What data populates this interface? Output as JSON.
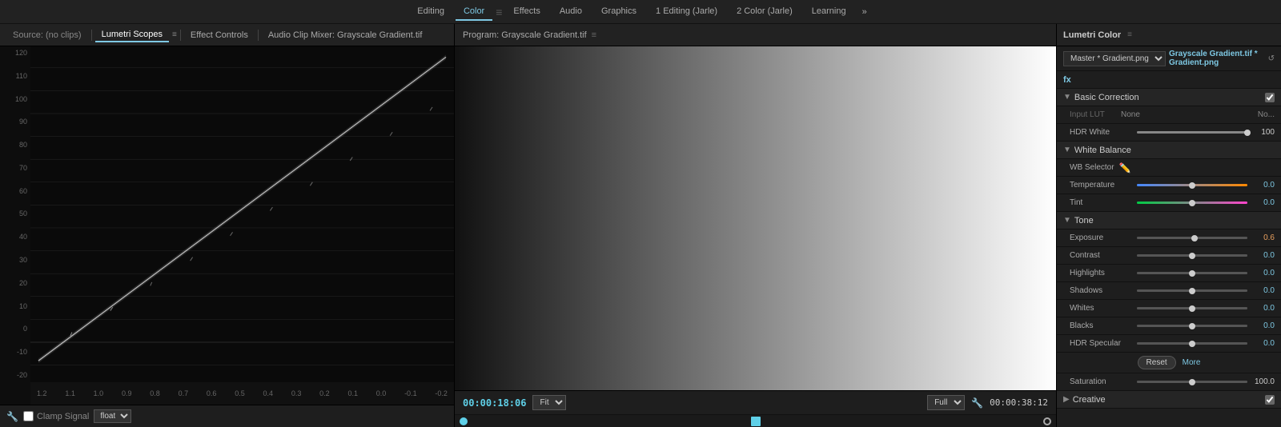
{
  "topNav": {
    "items": [
      {
        "label": "Editing",
        "active": false
      },
      {
        "label": "Color",
        "active": true
      },
      {
        "label": "Effects",
        "active": false
      },
      {
        "label": "Audio",
        "active": false
      },
      {
        "label": "Graphics",
        "active": false
      },
      {
        "label": "1 Editing (Jarle)",
        "active": false
      },
      {
        "label": "2 Color (Jarle)",
        "active": false
      },
      {
        "label": "Learning",
        "active": false
      }
    ],
    "moreIcon": "»"
  },
  "leftPanel": {
    "sourceLabel": "Source: (no clips)",
    "tabs": [
      {
        "label": "Lumetri Scopes",
        "active": true
      },
      {
        "label": "Effect Controls",
        "active": false
      },
      {
        "label": "Audio Clip Mixer: Grayscale Gradient.tif",
        "active": false
      }
    ],
    "menuIcon": "≡",
    "yAxisLabels": [
      "120",
      "110",
      "100",
      "90",
      "80",
      "70",
      "60",
      "50",
      "40",
      "30",
      "20",
      "10",
      "0",
      "-10",
      "-20"
    ],
    "xAxisLabels": [
      "1.2",
      "1.1",
      "1.0",
      "0.9",
      "0.8",
      "0.7",
      "0.6",
      "0.5",
      "0.4",
      "0.3",
      "0.2",
      "0.1",
      "0.0",
      "-0.1",
      "-0.2"
    ],
    "controls": {
      "clampSignalLabel": "Clamp Signal",
      "floatValue": "float"
    }
  },
  "centerPanel": {
    "programTitle": "Program: Grayscale Gradient.tif",
    "menuIcon": "≡",
    "timecode": "00:00:18:06",
    "fitOption": "Fit",
    "resolution": "Full",
    "duration": "00:00:38:12"
  },
  "rightPanel": {
    "title": "Lumetri Color",
    "menuIcon": "≡",
    "clipDropdown": "Master * Gradient.png",
    "clipName": "Grayscale Gradient.tif * Gradient.png",
    "resetIcon": "↺",
    "fxLabel": "fx",
    "sections": {
      "basicCorrection": {
        "label": "Basic Correction",
        "enabled": true,
        "inputLUT": {
          "label": "Input LUT",
          "value": "None",
          "edit": "No..."
        },
        "hdrWhite": {
          "label": "HDR White",
          "value": "100",
          "sliderPos": 100
        },
        "whiteBalance": {
          "label": "White Balance",
          "wbSelector": "WB Selector",
          "temperature": {
            "label": "Temperature",
            "value": "0.0",
            "sliderPos": 50
          },
          "tint": {
            "label": "Tint",
            "value": "0.0",
            "sliderPos": 50
          }
        },
        "tone": {
          "label": "Tone",
          "exposure": {
            "label": "Exposure",
            "value": "0.6",
            "sliderPos": 52
          },
          "contrast": {
            "label": "Contrast",
            "value": "0.0",
            "sliderPos": 50
          },
          "highlights": {
            "label": "Highlights",
            "value": "0.0",
            "sliderPos": 50
          },
          "shadows": {
            "label": "Shadows",
            "value": "0.0",
            "sliderPos": 50
          },
          "whites": {
            "label": "Whites",
            "value": "0.0",
            "sliderPos": 50
          },
          "blacks": {
            "label": "Blacks",
            "value": "0.0",
            "sliderPos": 50
          },
          "hdrSpecular": {
            "label": "HDR Specular",
            "value": "0.0",
            "sliderPos": 50
          }
        },
        "resetButton": "Reset",
        "moreLink": "More",
        "saturation": {
          "label": "Saturation",
          "value": "100.0",
          "sliderPos": 50
        }
      },
      "creative": {
        "label": "Creative",
        "enabled": true
      }
    }
  }
}
